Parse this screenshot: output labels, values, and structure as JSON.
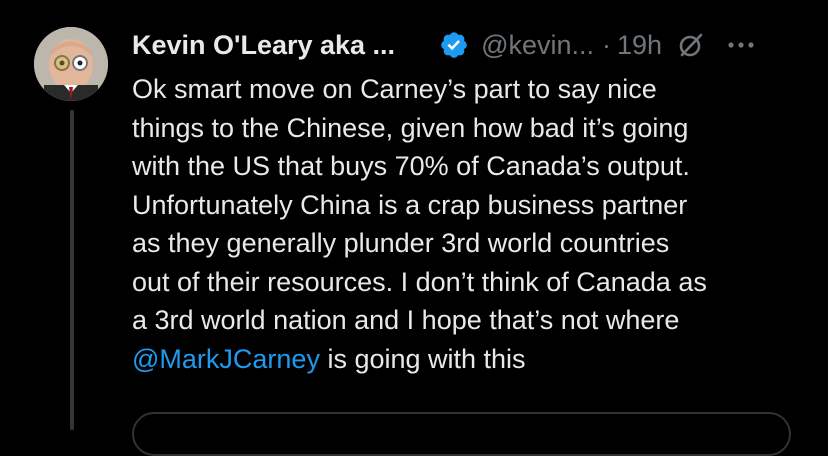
{
  "tweet": {
    "author": {
      "display_name": "Kevin O'Leary aka ...",
      "handle": "@kevin...",
      "verified": true,
      "avatar_icon": "avatar-photo"
    },
    "separator": "·",
    "time": "19h",
    "grok_icon": "grok-icon",
    "more_icon": "more-icon",
    "body_lines": [
      "Ok smart move on Carney’s part to say nice",
      "things to the Chinese, given how bad it’s going",
      "with the US that buys 70% of Canada’s output.",
      "Unfortunately China is a crap business partner",
      "as they generally plunder 3rd world countries",
      "out of their resources. I don’t think of Canada as",
      "a 3rd world nation and I hope that’s not where"
    ],
    "mention": "@MarkJCarney",
    "last_line_rest": " is going with this"
  },
  "colors": {
    "background": "#000000",
    "text": "#e7e9ea",
    "secondary": "#71767b",
    "link": "#1d9bf0",
    "verified_badge": "#1d9bf0",
    "thread_line": "#333639",
    "card_border": "#2f3336"
  }
}
